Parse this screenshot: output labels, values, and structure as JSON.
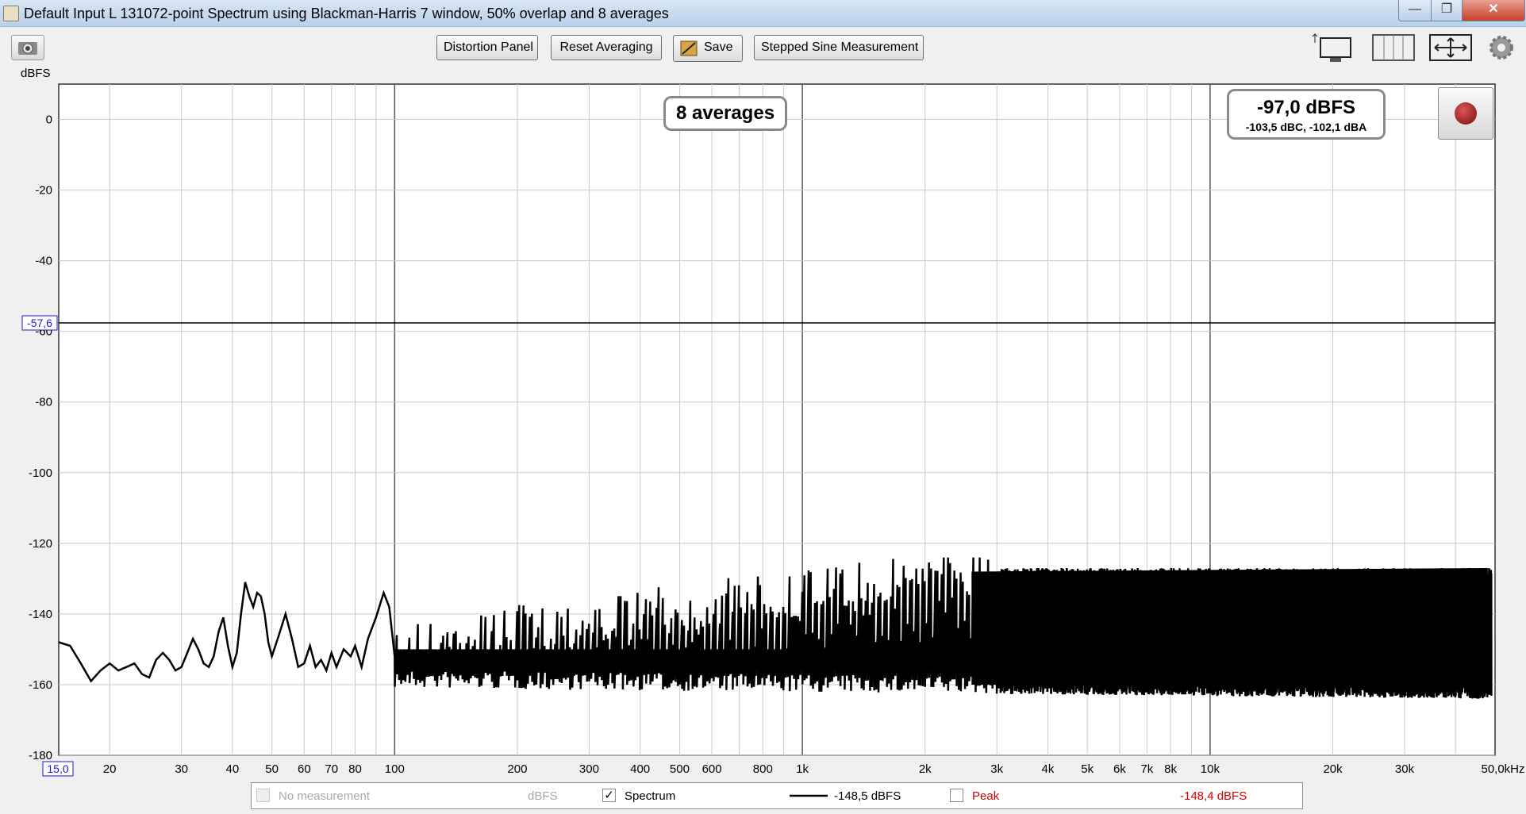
{
  "window": {
    "title": "Default Input L 131072-point Spectrum using Blackman-Harris 7 window, 50% overlap and 8 averages",
    "minimize_glyph": "—",
    "maximize_glyph": "❐",
    "close_glyph": "✕"
  },
  "toolbar": {
    "distortion_label": "Distortion Panel",
    "reset_label": "Reset Averaging",
    "save_label": "Save",
    "stepped_sine_label": "Stepped Sine Measurement",
    "icons": [
      "camera-icon",
      "resize-window-icon",
      "grid-columns-icon",
      "fit-axes-icon",
      "gear-icon"
    ]
  },
  "unit_label": "dBFS",
  "badges": {
    "averages": "8 averages",
    "level_main": "-97,0 dBFS",
    "level_sub": "-103,5 dBC, -102,1 dBA"
  },
  "cursors": {
    "y_value": -57.6,
    "y_label": "-57,6",
    "x_label": "15,0"
  },
  "legend": {
    "no_measurement": "No measurement",
    "no_measurement_unit": "dBFS",
    "spectrum_label": "Spectrum",
    "spectrum_checked": true,
    "spectrum_value": "-148,5 dBFS",
    "peak_label": "Peak",
    "peak_checked": false,
    "peak_value": "-148,4 dBFS",
    "peak_color": "#d40000"
  },
  "chart_data": {
    "type": "line",
    "x_scale": "log",
    "xlim": [
      15,
      50000
    ],
    "ylim": [
      -180,
      10
    ],
    "yticks": [
      0,
      -20,
      -40,
      -60,
      -80,
      -100,
      -120,
      -140,
      -160,
      -180
    ],
    "ytick_labels": [
      "0",
      "-20",
      "-40",
      "-60",
      "-80",
      "-100",
      "-120",
      "-140",
      "-160",
      "-180"
    ],
    "xticks": [
      20,
      30,
      40,
      50,
      60,
      70,
      80,
      100,
      200,
      300,
      400,
      500,
      600,
      800,
      1000,
      2000,
      3000,
      4000,
      5000,
      6000,
      7000,
      8000,
      10000,
      20000,
      30000,
      50000
    ],
    "xtick_labels": [
      "20",
      "30",
      "40",
      "50",
      "60",
      "70",
      "80",
      "100",
      "200",
      "300",
      "400",
      "500",
      "600",
      "800",
      "1k",
      "2k",
      "3k",
      "4k",
      "5k",
      "6k",
      "7k",
      "8k",
      "10k",
      "20k",
      "30k",
      "50,0kHz"
    ],
    "grid": true,
    "series": [
      {
        "name": "Spectrum",
        "color": "#000000",
        "envelope": "noise floor rises from about -155 dB at low frequencies to an upper band of about -127 dB above 3 kHz",
        "x": [
          15,
          16,
          17,
          18,
          19,
          20,
          21,
          22,
          23,
          24,
          25,
          26,
          27,
          28,
          29,
          30,
          31,
          32,
          33,
          34,
          35,
          36,
          37,
          38,
          39,
          40,
          41,
          42,
          43,
          44,
          45,
          46,
          47,
          48,
          49,
          50,
          52,
          54,
          56,
          58,
          60,
          62,
          64,
          66,
          68,
          70,
          72,
          75,
          78,
          80,
          83,
          86,
          90,
          94,
          97,
          100
        ],
        "y": [
          -148,
          -149,
          -154,
          -159,
          -156,
          -154,
          -156,
          -155,
          -154,
          -157,
          -158,
          -153,
          -151,
          -153,
          -156,
          -155,
          -151,
          -147,
          -150,
          -154,
          -155,
          -152,
          -145,
          -141,
          -149,
          -155,
          -151,
          -140,
          -131,
          -135,
          -138,
          -134,
          -135,
          -140,
          -148,
          -152,
          -146,
          -140,
          -147,
          -155,
          -154,
          -149,
          -155,
          -153,
          -156,
          -151,
          -155,
          -150,
          -152,
          -149,
          -155,
          -147,
          -141,
          -134,
          -138,
          -152
        ]
      }
    ]
  }
}
